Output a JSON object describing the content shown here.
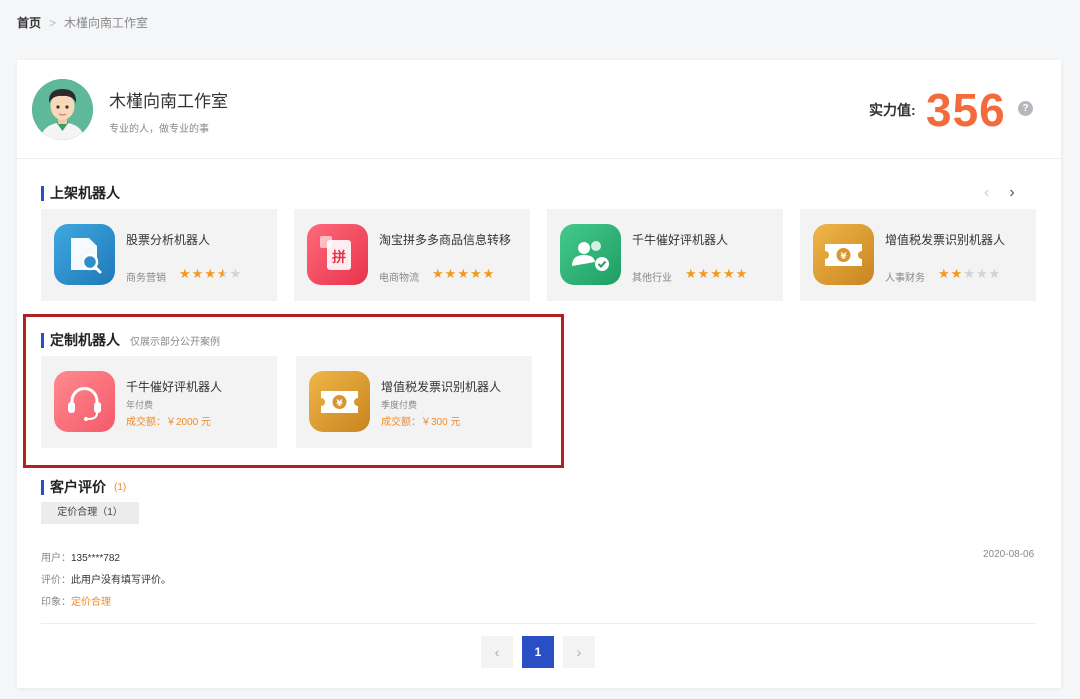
{
  "breadcrumb": {
    "home": "首页",
    "current": "木槿向南工作室"
  },
  "header": {
    "shop_name": "木槿向南工作室",
    "slogan": "专业的人，做专业的事",
    "power_label": "实力值:",
    "power_value": "356",
    "help_glyph": "?"
  },
  "listed": {
    "title": "上架机器人",
    "bots": [
      {
        "name": "股票分析机器人",
        "category": "商务营销",
        "rating": 3.5,
        "icon": "stock-analysis-icon",
        "color": "#2f8fc8"
      },
      {
        "name": "淘宝拼多多商品信息转移",
        "category": "电商物流",
        "rating": 5,
        "icon": "pinduoduo-icon",
        "color": "#f0455b"
      },
      {
        "name": "千牛催好评机器人",
        "category": "其他行业",
        "rating": 5,
        "icon": "users-check-icon",
        "color": "#2fb67a"
      },
      {
        "name": "增值税发票识别机器人",
        "category": "人事财务",
        "rating": 2,
        "icon": "yuan-ticket-icon",
        "color": "#e5a43a"
      }
    ]
  },
  "custom": {
    "title": "定制机器人",
    "subtitle": "仅展示部分公开案例",
    "bots": [
      {
        "name": "千牛催好评机器人",
        "pay": "年付费",
        "amount": "成交额：￥2000 元",
        "icon": "headset-icon",
        "color": "#f9707a"
      },
      {
        "name": "增值税发票识别机器人",
        "pay": "季度付费",
        "amount": "成交额：￥300 元",
        "icon": "yuan-ticket-icon",
        "color": "#e5a43a"
      }
    ]
  },
  "reviews": {
    "title": "客户评价",
    "count": "(1)",
    "tag": "定价合理（1）",
    "items": [
      {
        "user_label": "用户：",
        "user": "135****782",
        "date": "2020-08-06",
        "comment_label": "评价：",
        "comment": "此用户没有填写评价。",
        "impression_label": "印象：",
        "impression": "定价合理"
      }
    ]
  },
  "pagination": {
    "prev": "‹",
    "page": "1",
    "next": "›"
  }
}
